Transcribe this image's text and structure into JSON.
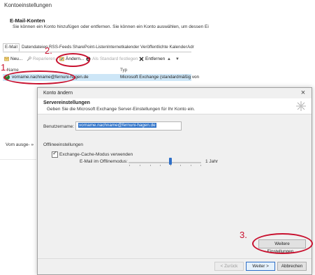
{
  "background_window": {
    "title": "Kontoeinstellungen",
    "section_title": "E-Mail-Konten",
    "section_description": "Sie können ein Konto hinzufügen oder entfernen. Sie können ein Konto auswählen, um dessen Ei",
    "tabs": [
      "E-Mail",
      "Datendateien",
      "RSS-Feeds",
      "SharePoint-Listen",
      "Internetkalender",
      "Veröffentlichte Kalender",
      "Adr"
    ],
    "active_tab": "E-Mail",
    "toolbar": {
      "new": "Neu...",
      "repair": "Reparieren...",
      "change": "Ändern...",
      "set_default": "Als Standard festlegen",
      "remove": "Entfernen",
      "up_arrow": "▲",
      "down_arrow": "▼"
    },
    "list_columns": {
      "name": "Name",
      "type": "Typ"
    },
    "accounts": [
      {
        "name": "vorname.nachname@fernuni-hagen.de",
        "type": "Microsoft Exchange (standardmäßig von"
      }
    ],
    "store_label": "Vom ausge-",
    "store_arrow": "»"
  },
  "annotations": {
    "step1": "1.",
    "step2": "2.",
    "step3": "3.",
    "color": "#c8102e"
  },
  "dialog": {
    "title": "Konto ändern",
    "close": "×",
    "header_title": "Servereinstellungen",
    "header_description": "Geben Sie die Microsoft Exchange Server-Einstellungen für Ihr Konto ein.",
    "username_label": "Benutzername:",
    "username_value": "vorname.nachname@fernuni-hagen.de",
    "offline_section": "Offlineeinstellungen",
    "cache_mode_label": "Exchange-Cache-Modus verwenden",
    "cache_mode_checked": true,
    "cache_check_glyph": "✓",
    "offline_mail_label": "E-Mail im Offlinemodus:",
    "offline_mail_value": "1 Jahr",
    "more_settings": "Weitere Einstellungen...",
    "back": "< Zurück",
    "next": "Weiter >",
    "cancel": "Abbrechen"
  },
  "colors": {
    "accent": "#2e6fc8",
    "selection": "#cde6f7"
  }
}
